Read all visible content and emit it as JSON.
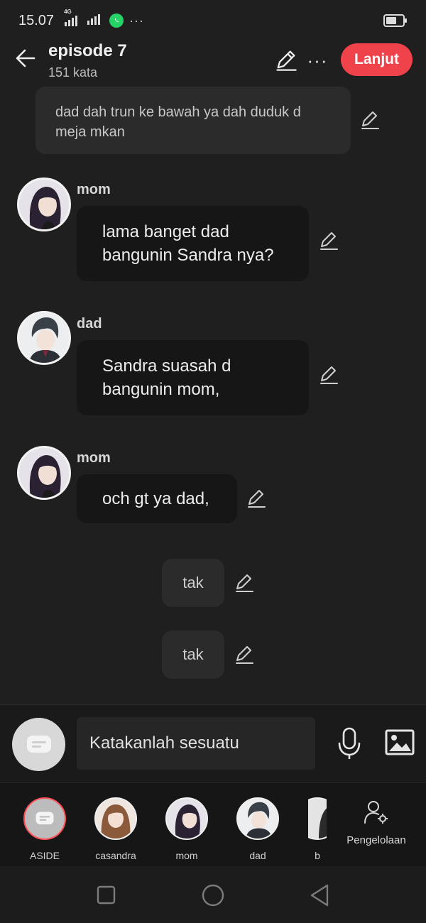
{
  "status_bar": {
    "time": "15.07",
    "network": "4G",
    "more": "···"
  },
  "header": {
    "title": "episode 7",
    "word_count": "151 kata",
    "continue_label": "Lanjut",
    "more": "···"
  },
  "chat": {
    "narration": "dad dah trun ke bawah ya dah duduk d meja mkan",
    "messages": [
      {
        "speaker": "mom",
        "text": "lama banget dad bangunin Sandra nya?"
      },
      {
        "speaker": "dad",
        "text": "Sandra suasah d bangunin mom,"
      },
      {
        "speaker": "mom",
        "text": "och gt ya dad,"
      }
    ],
    "centered": [
      "tak",
      "tak"
    ]
  },
  "input": {
    "placeholder": "Katakanlah sesuatu"
  },
  "characters": [
    {
      "name": "ASIDE"
    },
    {
      "name": "casandra"
    },
    {
      "name": "mom"
    },
    {
      "name": "dad"
    },
    {
      "name": "b"
    }
  ],
  "manage_label": "Pengelolaan",
  "colors": {
    "accent": "#f0424b",
    "background": "#1f1f1f",
    "whatsapp": "#25d366"
  }
}
